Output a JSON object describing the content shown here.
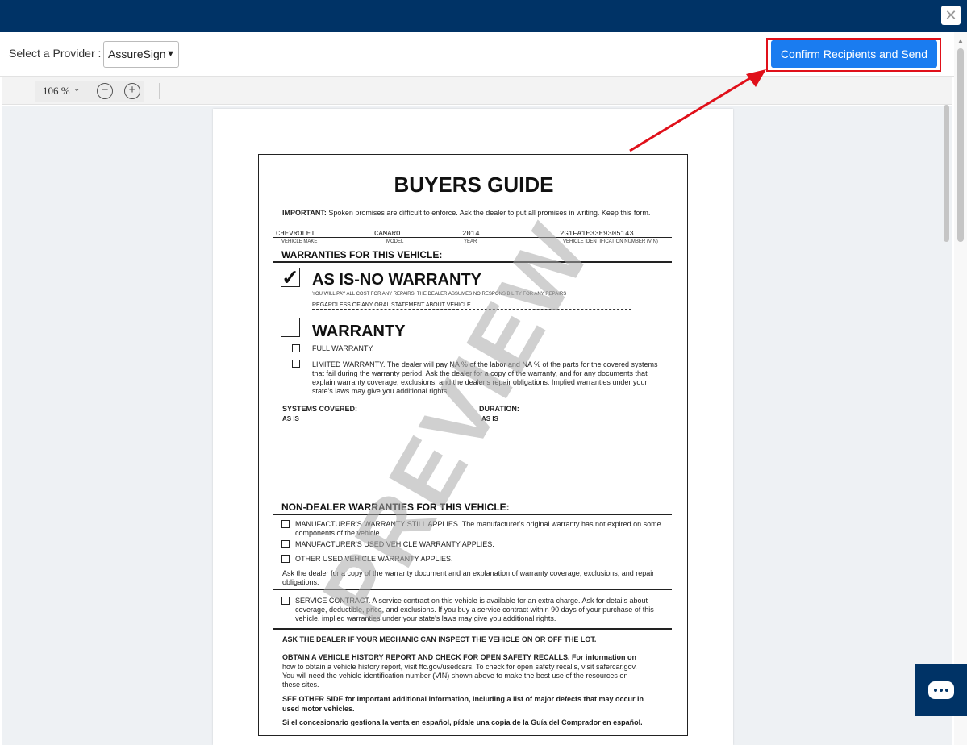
{
  "header": {
    "close_symbol": "✕"
  },
  "toolbar": {
    "provider_label": "Select a Provider :",
    "provider_selected": "AssureSign",
    "confirm_label": "Confirm Recipients and Send"
  },
  "viewer": {
    "zoom": "106 %",
    "zoom_out_symbol": "−",
    "zoom_in_symbol": "+"
  },
  "document": {
    "title": "BUYERS GUIDE",
    "important_label": "IMPORTANT:",
    "important_text": "Spoken promises are difficult to enforce.  Ask the dealer to put all promises in writing.  Keep this form.",
    "vehicle": {
      "make": "CHEVROLET",
      "model": "CAMARO",
      "year": "2014",
      "vin": "2G1FA1E33E9305143",
      "make_caption": "VEHICLE MAKE",
      "model_caption": "MODEL",
      "year_caption": "YEAR",
      "vin_caption": "VEHICLE IDENTIFICATION NUMBER (VIN)"
    },
    "warranties_heading": "WARRANTIES FOR THIS VEHICLE:",
    "as_is_title": "AS IS-NO WARRANTY",
    "as_is_check": "✓",
    "as_is_line1": "YOU WILL PAY ALL COST FOR ANY REPAIRS. THE DEALER ASSUMES NO RESPONSIBILITY FOR ANY REPAIRS",
    "as_is_line2": "REGARDLESS OF ANY ORAL STATEMENT ABOUT VEHICLE.",
    "warranty_title": "WARRANTY",
    "full_warranty": "FULL WARRANTY.",
    "limited_line1": "LIMITED WARRANTY.  The dealer will pay NA    % of the labor and NA    % of the parts for the covered systems",
    "limited_line2": "that fail during the warranty period.  Ask the dealer for a copy of the warranty, and for any documents that",
    "limited_line3": "explain warranty coverage, exclusions, and the dealer's repair obligations.  Implied warranties under your",
    "limited_line4": "state's laws may give you additional rights.",
    "systems_label": "SYSTEMS COVERED:",
    "systems_value": "AS IS",
    "duration_label": "DURATION:",
    "duration_value": "AS IS",
    "non_dealer_heading": "NON-DEALER WARRANTIES FOR THIS VEHICLE:",
    "mfr_still_1": "MANUFACTURER'S WARRANTY STILL APPLIES.  The manufacturer's original warranty has not expired on some",
    "mfr_still_2": "components of the vehicle.",
    "mfr_used": "MANUFACTURER'S USED VEHICLE WARRANTY APPLIES.",
    "other_used": "OTHER USED VEHICLE WARRANTY APPLIES.",
    "ask_copy_1": "Ask the dealer for a copy of the warranty document and an explanation of warranty coverage, exclusions, and repair",
    "ask_copy_2": "obligations.",
    "service_1": "SERVICE CONTRACT.  A service contract on this vehicle is available for an extra charge.  Ask for details about",
    "service_2": "coverage, deductible, price, and exclusions.  If you buy a service contract within 90 days of your purchase of this",
    "service_3": "vehicle, implied warranties under your state's laws may give you additional rights.",
    "mechanic": "ASK THE DEALER IF YOUR MECHANIC CAN INSPECT THE VEHICLE ON OR OFF THE LOT.",
    "history_1": "OBTAIN A VEHICLE HISTORY REPORT AND CHECK FOR OPEN SAFETY RECALLS.  For information on",
    "history_2": "how to obtain a vehicle history report, visit ftc.gov/usedcars.  To check for open safety recalls, visit safercar.gov.",
    "history_3": "You will need the vehicle identification number (VIN) shown above to make the best use of the resources on",
    "history_4": "these sites.",
    "other_side_1": "SEE OTHER SIDE for important additional information, including a list of major defects that may occur in",
    "other_side_2": "used motor vehicles.",
    "spanish": "Si el concesionario gestiona la venta en español, pídale una copia de la Guía del Comprador en español.",
    "watermark": "PREVIEW"
  },
  "colors": {
    "topbar": "#003366",
    "confirm_button": "#1a7cf0",
    "highlight": "#e0101a"
  }
}
